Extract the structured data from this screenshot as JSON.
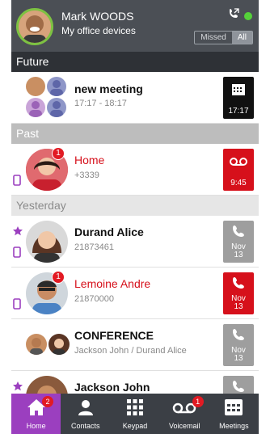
{
  "header": {
    "user_name": "Mark WOODS",
    "device_label": "My office devices",
    "filter_options": [
      "Missed",
      "All"
    ],
    "active_filter": "All"
  },
  "sections": {
    "future": "Future",
    "past": "Past",
    "yesterday": "Yesterday"
  },
  "future_items": [
    {
      "title": "new meeting",
      "subtitle": "17:17 - 18:17",
      "tile_label": "17:17",
      "icon": "calendar-icon"
    }
  ],
  "past_items": [
    {
      "title": "Home",
      "subtitle": "+3339",
      "badge": "1",
      "tile_label": "9:45",
      "icon": "voicemail-icon",
      "missed": true
    }
  ],
  "yesterday_items": [
    {
      "title": "Durand Alice",
      "subtitle": "21873461",
      "tile_label": "Nov\n13",
      "icon": "phone-icon",
      "favorite": true
    },
    {
      "title": "Lemoine Andre",
      "subtitle": "21870000",
      "badge": "1",
      "tile_label": "Nov\n13",
      "icon": "phone-icon",
      "missed": true
    },
    {
      "title": "CONFERENCE",
      "subtitle": "Jackson John / Durand Alice",
      "tile_label": "Nov\n13",
      "icon": "phone-icon"
    },
    {
      "title": "Jackson John",
      "subtitle": "",
      "tile_label": "",
      "icon": "phone-icon",
      "favorite": true
    }
  ],
  "nav": [
    {
      "label": "Home",
      "badge": "2",
      "icon": "home-icon",
      "active": true
    },
    {
      "label": "Contacts",
      "icon": "contacts-icon"
    },
    {
      "label": "Keypad",
      "icon": "keypad-icon"
    },
    {
      "label": "Voicemail",
      "badge": "1",
      "icon": "voicemail-icon"
    },
    {
      "label": "Meetings",
      "icon": "meetings-icon"
    }
  ],
  "colors": {
    "header_bg": "#4b4f55",
    "accent_purple": "#9b3fbf",
    "missed_red": "#d6101b",
    "presence_green": "#55d13a"
  }
}
